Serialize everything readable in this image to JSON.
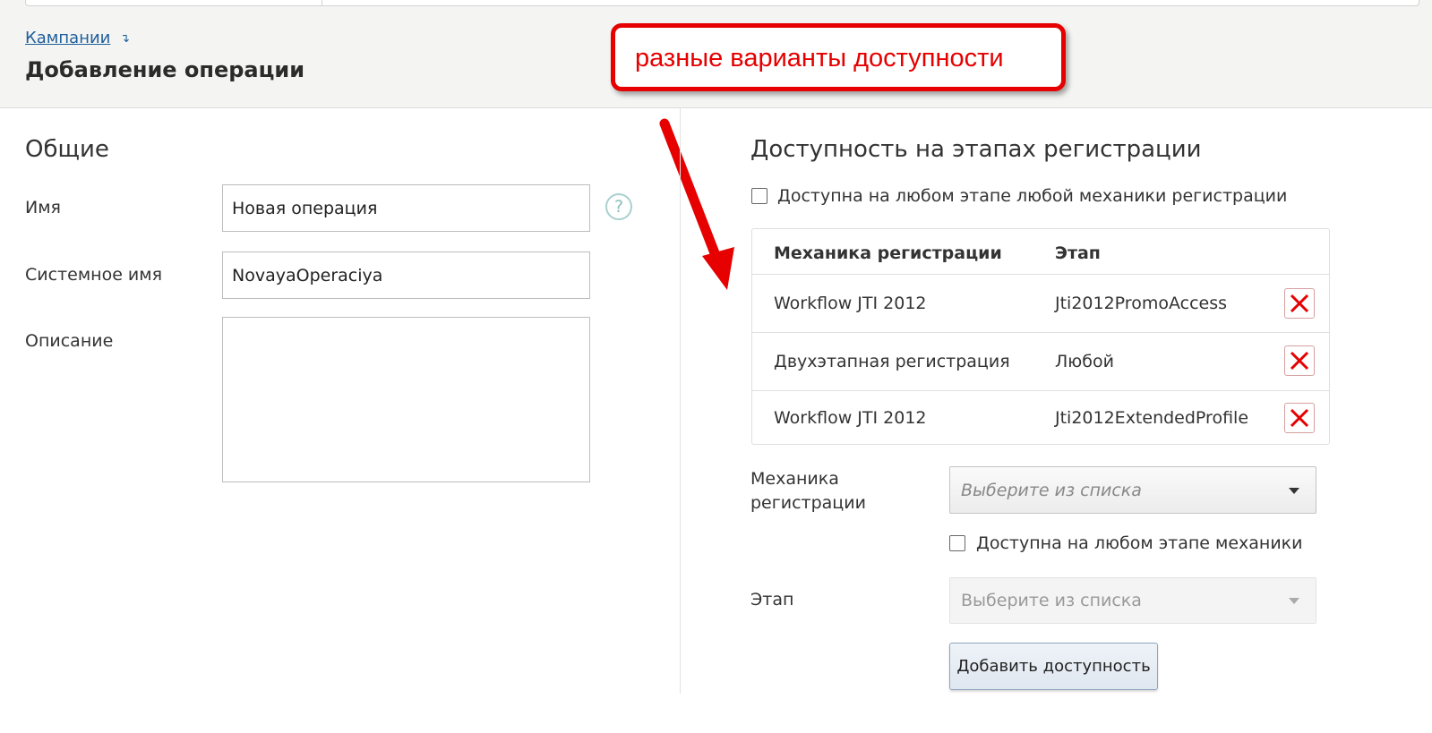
{
  "header": {
    "breadcrumb": "Кампании",
    "breadcrumb_arrow": "↴",
    "title": "Добавление операции"
  },
  "annotation": {
    "text": "разные варианты доступности",
    "color": "#e60000"
  },
  "general": {
    "section_title": "Общие",
    "name_label": "Имя",
    "name_value": "Новая операция",
    "help_symbol": "?",
    "system_name_label": "Системное имя",
    "system_name_value": "NovayaOperaciya",
    "description_label": "Описание",
    "description_value": ""
  },
  "availability": {
    "section_title": "Доступность на этапах регистрации",
    "any_stage_any_mechanic_label": "Доступна на любом этапе любой механики регистрации",
    "any_stage_any_mechanic_checked": false,
    "table": {
      "columns": [
        "Механика регистрации",
        "Этап"
      ],
      "rows": [
        {
          "mechanic": "Workflow JTI 2012",
          "stage": "Jti2012PromoAccess"
        },
        {
          "mechanic": "Двухэтапная регистрация",
          "stage": "Любой"
        },
        {
          "mechanic": "Workflow JTI 2012",
          "stage": "Jti2012ExtendedProfile"
        }
      ]
    },
    "mechanic_label": "Механика регистрации",
    "mechanic_placeholder": "Выберите из списка",
    "any_stage_mechanic_label": "Доступна на любом этапе механики",
    "any_stage_mechanic_checked": false,
    "stage_label": "Этап",
    "stage_placeholder": "Выберите из списка",
    "add_button": "Добавить доступность"
  }
}
